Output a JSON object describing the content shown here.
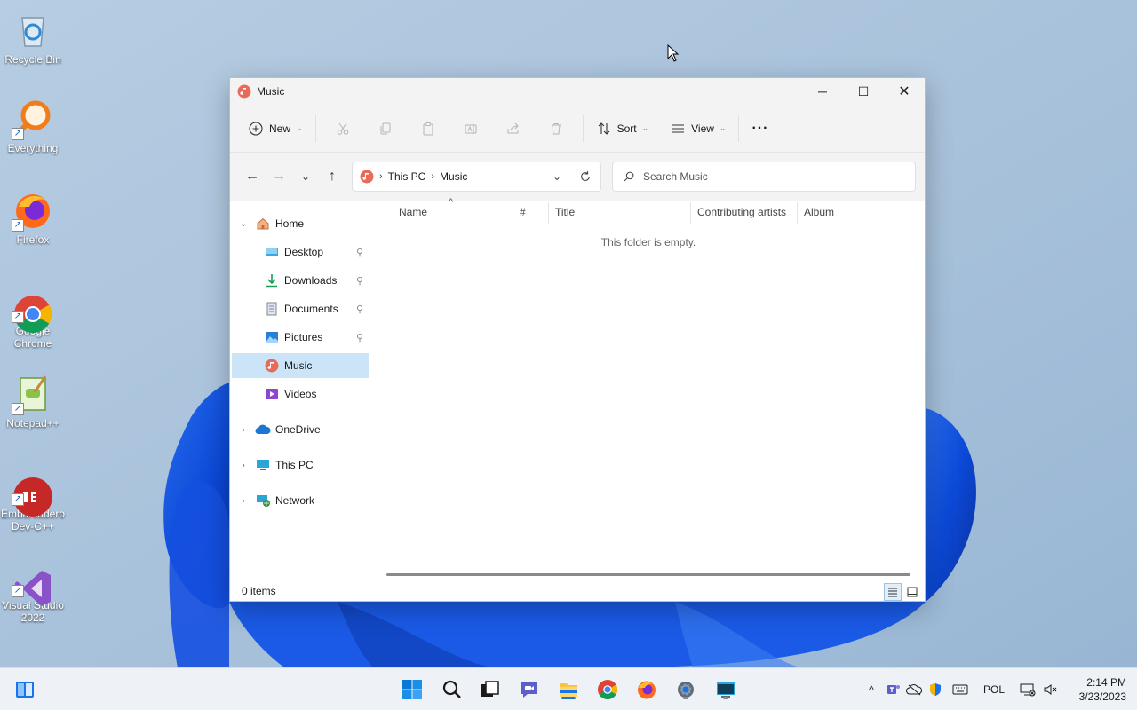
{
  "desktop": {
    "icons": [
      {
        "label": "Recycle Bin",
        "icon": "recycle-bin-icon",
        "shortcut": false
      },
      {
        "label": "Everything",
        "icon": "everything-search-icon",
        "shortcut": true
      },
      {
        "label": "Firefox",
        "icon": "firefox-icon",
        "shortcut": true
      },
      {
        "label": "Google\nChrome",
        "icon": "chrome-icon",
        "shortcut": true
      },
      {
        "label": "Notepad++",
        "icon": "notepadpp-icon",
        "shortcut": true
      },
      {
        "label": "Embarcadero\nDev-C++",
        "icon": "devcpp-icon",
        "shortcut": true
      },
      {
        "label": "Visual Studio\n2022",
        "icon": "visual-studio-icon",
        "shortcut": true
      }
    ]
  },
  "window": {
    "title": "Music",
    "title_icon": "music-folder-icon",
    "controls": {
      "minimize": "─",
      "maximize": "☐",
      "close": "✕"
    },
    "toolbar": {
      "new_label": "New",
      "sort_label": "Sort",
      "view_label": "View",
      "more_label": "···",
      "icons": [
        "cut-icon",
        "copy-icon",
        "paste-icon",
        "rename-icon",
        "share-icon",
        "delete-icon"
      ]
    },
    "address": {
      "crumbs": [
        "This PC",
        "Music"
      ],
      "separator": "›"
    },
    "search": {
      "placeholder": "Search Music"
    },
    "nav": {
      "home": "Home",
      "quick_access": [
        {
          "label": "Desktop",
          "icon": "desktop-folder-icon",
          "pinned": true
        },
        {
          "label": "Downloads",
          "icon": "downloads-icon",
          "pinned": true
        },
        {
          "label": "Documents",
          "icon": "documents-icon",
          "pinned": true
        },
        {
          "label": "Pictures",
          "icon": "pictures-icon",
          "pinned": true
        },
        {
          "label": "Music",
          "icon": "music-folder-icon",
          "pinned": false,
          "selected": true
        },
        {
          "label": "Videos",
          "icon": "videos-icon",
          "pinned": false
        }
      ],
      "onedrive": "OneDrive",
      "thispc": "This PC",
      "network": "Network",
      "pin_glyph": "📌"
    },
    "columns": [
      "Name",
      "#",
      "Title",
      "Contributing artists",
      "Album"
    ],
    "sort_indicator": "^",
    "empty_message": "This folder is empty.",
    "status": "0 items"
  },
  "taskbar": {
    "apps": [
      "start-icon",
      "search-icon",
      "task-view-icon",
      "chat-icon",
      "file-explorer-icon",
      "chrome-icon",
      "firefox-icon",
      "settings-icon",
      "terminal-icon"
    ],
    "tray": {
      "chevron": "^",
      "language": "POL",
      "time": "2:14 PM",
      "date": "3/23/2023"
    }
  },
  "colors": {
    "accent": "#1a73e8",
    "selection": "#cce4f7",
    "wallpaper": "#a9c3db"
  }
}
